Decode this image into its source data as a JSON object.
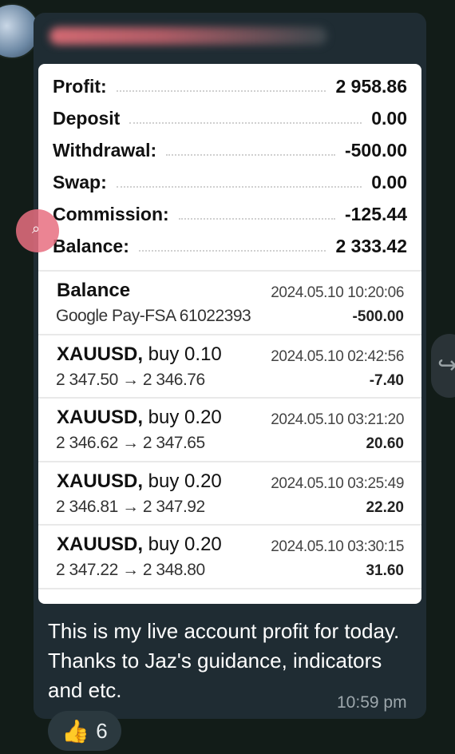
{
  "summary": [
    {
      "label": "Profit:",
      "value": "2 958.86"
    },
    {
      "label": "Deposit",
      "value": "0.00"
    },
    {
      "label": "Withdrawal:",
      "value": "-500.00"
    },
    {
      "label": "Swap:",
      "value": "0.00"
    },
    {
      "label": "Commission:",
      "value": "-125.44"
    },
    {
      "label": "Balance:",
      "value": "2 333.42"
    }
  ],
  "deals": [
    {
      "title_symbol": "Balance",
      "title_rest": "",
      "subtitle": "Google Pay-FSA 61022393",
      "time": "2024.05.10 10:20:06",
      "amount": "-500.00"
    },
    {
      "title_symbol": "XAUUSD,",
      "title_rest": " buy 0.10",
      "subtitle": "2 347.50 → 2 346.76",
      "time": "2024.05.10 02:42:56",
      "amount": "-7.40"
    },
    {
      "title_symbol": "XAUUSD,",
      "title_rest": " buy 0.20",
      "subtitle": "2 346.62 → 2 347.65",
      "time": "2024.05.10 03:21:20",
      "amount": "20.60"
    },
    {
      "title_symbol": "XAUUSD,",
      "title_rest": " buy 0.20",
      "subtitle": "2 346.81 → 2 347.92",
      "time": "2024.05.10 03:25:49",
      "amount": "22.20"
    },
    {
      "title_symbol": "XAUUSD,",
      "title_rest": " buy 0.20",
      "subtitle": "2 347.22 → 2 348.80",
      "time": "2024.05.10 03:30:15",
      "amount": "31.60"
    }
  ],
  "message": {
    "text": "This is my live account profit for today. Thanks to Jaz's guidance, indicators and etc.",
    "time": "10:59 pm"
  },
  "reaction": {
    "emoji": "👍",
    "count": "6"
  },
  "icons": {
    "avatar": "user-avatar",
    "search": "search-icon",
    "share": "share-icon"
  }
}
